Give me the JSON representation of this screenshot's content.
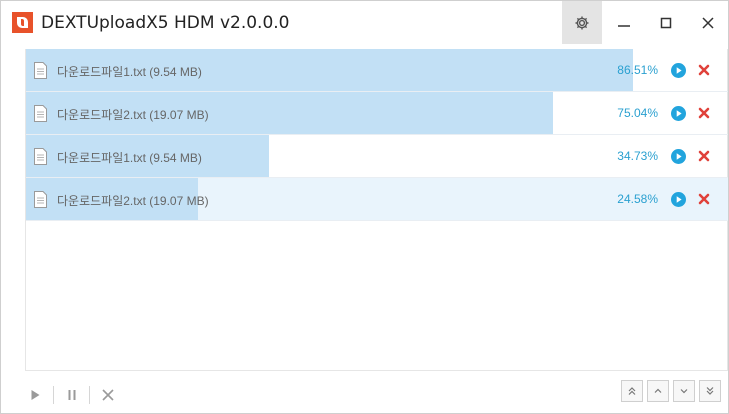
{
  "window": {
    "title": "DEXTUploadX5 HDM v2.0.0.0",
    "logo_icon": "dext-logo-icon",
    "buttons": [
      "settings-icon",
      "minimize-icon",
      "maximize-icon",
      "close-icon"
    ]
  },
  "downloads": [
    {
      "file_name": "다운로드파일1.txt (9.54 MB)",
      "percent": "86.51%",
      "progress": 0.8651
    },
    {
      "file_name": "다운로드파일2.txt (19.07 MB)",
      "percent": "75.04%",
      "progress": 0.7504
    },
    {
      "file_name": "다운로드파일1.txt (9.54 MB)",
      "percent": "34.73%",
      "progress": 0.3473
    },
    {
      "file_name": "다운로드파일2.txt (19.07 MB)",
      "percent": "24.58%",
      "progress": 0.2458
    }
  ],
  "colors": {
    "accent": "#2aa0d0",
    "progress_fill": "#c2e0f5",
    "remove": "#e0413a",
    "logo": "#e8522a"
  },
  "toolbar": {
    "left_buttons": [
      "play-icon",
      "pause-icon",
      "stop-icon"
    ],
    "order_buttons": [
      "move-top-icon",
      "move-up-icon",
      "move-down-icon",
      "move-bottom-icon"
    ]
  }
}
